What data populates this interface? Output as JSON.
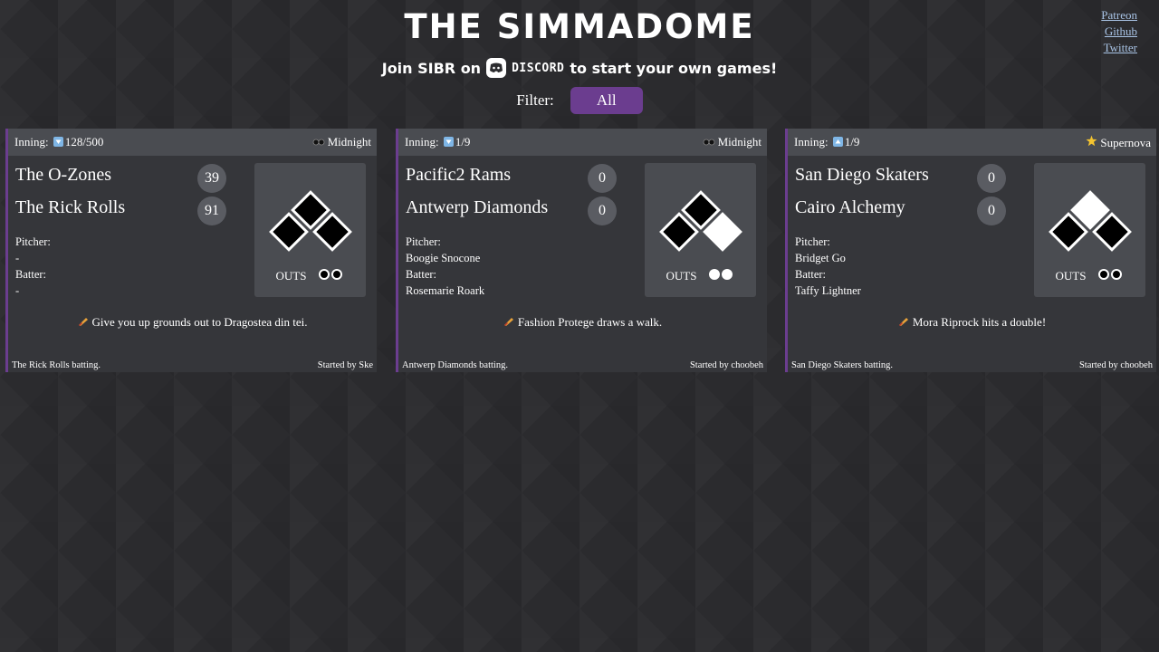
{
  "header": {
    "title": "THE SIMMADOME",
    "join_prefix": "Join SIBR on",
    "discord_word": "DISCORD",
    "join_suffix": "to start your own games!",
    "links": [
      "Patreon",
      "Github",
      "Twitter"
    ]
  },
  "filter": {
    "label": "Filter:",
    "selected": "All"
  },
  "colors": {
    "accent": "#6b3d8f",
    "card_bg": "#35363a",
    "card_header_bg": "#4a4c51",
    "link": "#a9c4e6"
  },
  "games": [
    {
      "inning_label": "Inning:",
      "inning_icon": "arrow-down-icon",
      "inning": "128/500",
      "weather_icon": "eclipse-icon",
      "weather": "Midnight",
      "away_team": "The O-Zones",
      "away_score": "39",
      "home_team": "The Rick Rolls",
      "home_score": "91",
      "pitcher_label": "Pitcher:",
      "pitcher": "-",
      "batter_label": "Batter:",
      "batter": "-",
      "bases": [
        false,
        false,
        false
      ],
      "outs_label": "OUTS",
      "outs": [
        false,
        false
      ],
      "update": "Give you up grounds out to Dragostea din tei.",
      "batting": "The Rick Rolls batting.",
      "started_by": "Started by Ske"
    },
    {
      "inning_label": "Inning:",
      "inning_icon": "arrow-down-icon",
      "inning": "1/9",
      "weather_icon": "eclipse-icon",
      "weather": "Midnight",
      "away_team": "Pacific2 Rams",
      "away_score": "0",
      "home_team": "Antwerp Diamonds",
      "home_score": "0",
      "pitcher_label": "Pitcher:",
      "pitcher": "Boogie Snocone",
      "batter_label": "Batter:",
      "batter": "Rosemarie Roark",
      "bases": [
        true,
        false,
        false
      ],
      "outs_label": "OUTS",
      "outs": [
        true,
        true
      ],
      "update": "Fashion Protege draws a walk.",
      "batting": "Antwerp Diamonds batting.",
      "started_by": "Started by choobeh"
    },
    {
      "inning_label": "Inning:",
      "inning_icon": "arrow-up-icon",
      "inning": "1/9",
      "weather_icon": "star-icon",
      "weather": "Supernova",
      "away_team": "San Diego Skaters",
      "away_score": "0",
      "home_team": "Cairo Alchemy",
      "home_score": "0",
      "pitcher_label": "Pitcher:",
      "pitcher": "Bridget Go",
      "batter_label": "Batter:",
      "batter": "Taffy Lightner",
      "bases": [
        false,
        true,
        false
      ],
      "outs_label": "OUTS",
      "outs": [
        false,
        false
      ],
      "update": "Mora Riprock hits a double!",
      "batting": "San Diego Skaters batting.",
      "started_by": "Started by choobeh"
    }
  ]
}
